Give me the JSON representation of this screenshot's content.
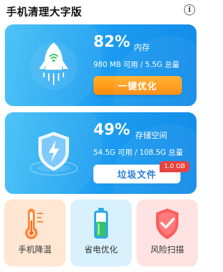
{
  "app": {
    "title": "手机清理大字版"
  },
  "memory": {
    "percent": "82%",
    "label": "内存",
    "detail": "980 MB 可用 / 5.5G 总量",
    "button": "一键优化"
  },
  "storage": {
    "percent": "49%",
    "label": "存储空间",
    "detail": "54.5G 可用 / 108.5G 总量",
    "button": "垃圾文件",
    "badge": "1.0 GB"
  },
  "tools": [
    {
      "label": "手机降温",
      "icon": "thermometer-icon"
    },
    {
      "label": "省电优化",
      "icon": "battery-icon"
    },
    {
      "label": "风险扫描",
      "icon": "shield-check-icon"
    }
  ],
  "colors": {
    "card_blue": "#1a9bf0",
    "orange": "#ff8a0c",
    "badge_red": "#e53935",
    "tile_orange": "#ffe7d3",
    "tile_blue": "#d9f1fc",
    "tile_red": "#ffe3e3"
  }
}
